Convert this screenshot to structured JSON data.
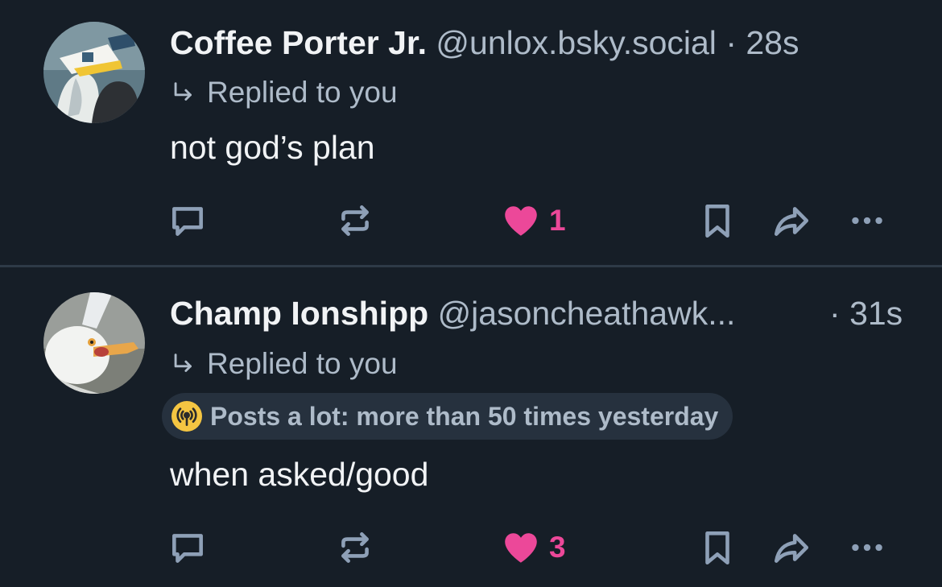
{
  "posts": [
    {
      "display_name": "Coffee Porter Jr.",
      "handle": "@unlox.bsky.social",
      "separator": "·",
      "time": "28s",
      "reply_label": "Replied to you",
      "text": "not god’s plan",
      "like_count": "1",
      "liked": true
    },
    {
      "display_name": "Champ Ionshipp",
      "handle": "@jasoncheathawk...",
      "separator": "·",
      "time": "31s",
      "reply_label": "Replied to you",
      "badge": "Posts a lot: more than 50 times yesterday",
      "text": "when asked/good",
      "like_count": "3",
      "liked": true
    }
  ],
  "colors": {
    "background": "#161e27",
    "primary_text": "#f1f3f5",
    "secondary_text": "#aebbc9",
    "icon": "#8ea0b7",
    "like": "#ec4899",
    "badge_bg": "#26313e",
    "badge_icon": "#f4c542",
    "divider": "#2e3a47"
  },
  "icons": {
    "reply": "speech-bubble-icon",
    "repost": "repost-arrows-icon",
    "like": "heart-icon",
    "bookmark": "bookmark-icon",
    "share": "share-arrow-icon",
    "more": "ellipsis-icon",
    "replied": "reply-arrow-icon",
    "badge": "broadcast-icon"
  }
}
